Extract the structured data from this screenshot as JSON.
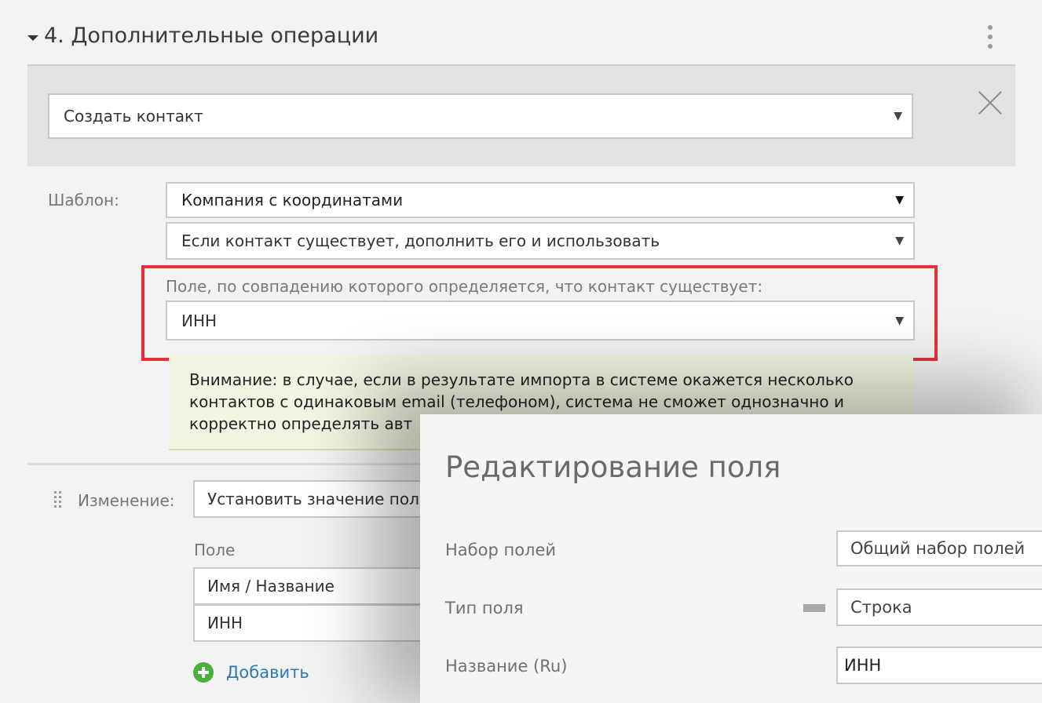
{
  "section": {
    "title": "4. Дополнительные операции"
  },
  "operation": {
    "type_select": "Создать контакт"
  },
  "template": {
    "label": "Шаблон:",
    "template_select": "Компания с координатами",
    "exists_mode_select": "Если контакт существует, дополнить его и использовать",
    "match_field_label": "Поле, по совпадению которого определяется, что контакт существует:",
    "match_field_select": "ИНН"
  },
  "warning": {
    "line1": "Внимание: в случае, если в результате импорта в системе окажется несколько",
    "line2": "контактов с одинаковым email (телефоном), система не сможет однозначно и",
    "line3": "корректно определять авт"
  },
  "change": {
    "label": "Изменение:",
    "action_select": "Установить значение пол",
    "field_label": "Поле",
    "fields": [
      "Имя / Название",
      "ИНН"
    ],
    "add_label": "Добавить"
  },
  "modal": {
    "title": "Редактирование поля",
    "fieldset_label": "Набор полей",
    "fieldset_value": "Общий набор полей",
    "type_label": "Тип поля",
    "type_value": "Строка",
    "name_label": "Название (Ru)",
    "name_value": "ИНН"
  },
  "colors": {
    "highlight": "#e3303b",
    "link": "#2f79b5",
    "add_icon": "#4cae3c",
    "warning_bg": "#f0f5e1"
  }
}
